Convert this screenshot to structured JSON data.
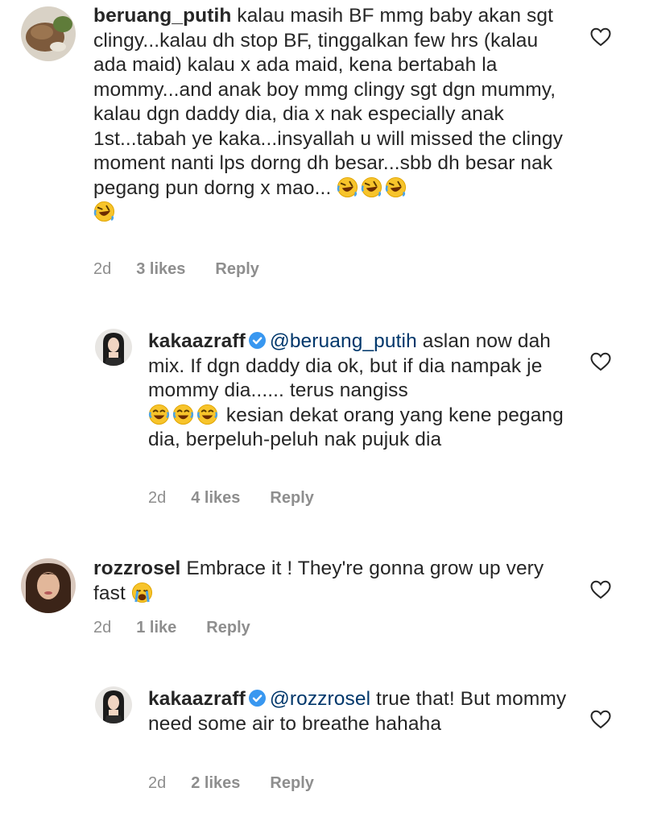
{
  "comments": [
    {
      "username": "beruang_putih",
      "text": "kalau masih BF mmg baby akan sgt clingy...kalau dh stop BF, tinggalkan few hrs (kalau ada maid) kalau x ada maid, kena bertabah la mommy...and anak boy mmg clingy sgt dgn mummy, kalau dgn daddy dia, dia x nak especially anak 1st...tabah ye kaka...insyallah u will missed the clingy moment nanti lps dorng dh besar...sbb dh besar nak pegang pun dorng x mao...",
      "emojis": [
        "rofl-emoji",
        "rofl-emoji",
        "rofl-emoji",
        "rofl-emoji"
      ],
      "time": "2d",
      "likes": "3 likes",
      "reply": "Reply"
    },
    {
      "username": "kakaazraff",
      "verified": true,
      "mention": "@beruang_putih",
      "text_before_emoji": "aslan now dah mix. If dgn daddy dia ok, but if dia nampak je mommy dia...... terus nangiss",
      "emojis": [
        "tears-of-joy-emoji",
        "tears-of-joy-emoji",
        "tears-of-joy-emoji"
      ],
      "text_after_emoji": "kesian dekat orang yang kene pegang dia, berpeluh-peluh nak pujuk dia",
      "time": "2d",
      "likes": "4 likes",
      "reply": "Reply"
    },
    {
      "username": "rozzrosel",
      "text": "Embrace it ! They're gonna grow up very fast",
      "emojis": [
        "loudly-crying-emoji"
      ],
      "time": "2d",
      "likes": "1 like",
      "reply": "Reply"
    },
    {
      "username": "kakaazraff",
      "verified": true,
      "mention": "@rozzrosel",
      "text": "true that! But mommy need some air to breathe hahaha",
      "time": "2d",
      "likes": "2 likes",
      "reply": "Reply"
    }
  ],
  "icons": {
    "like": "heart-outline-icon",
    "verified": "verified-badge-icon"
  },
  "colors": {
    "text": "#262626",
    "meta": "#8e8e8e",
    "mention": "#00376b",
    "verified": "#3897f0"
  }
}
